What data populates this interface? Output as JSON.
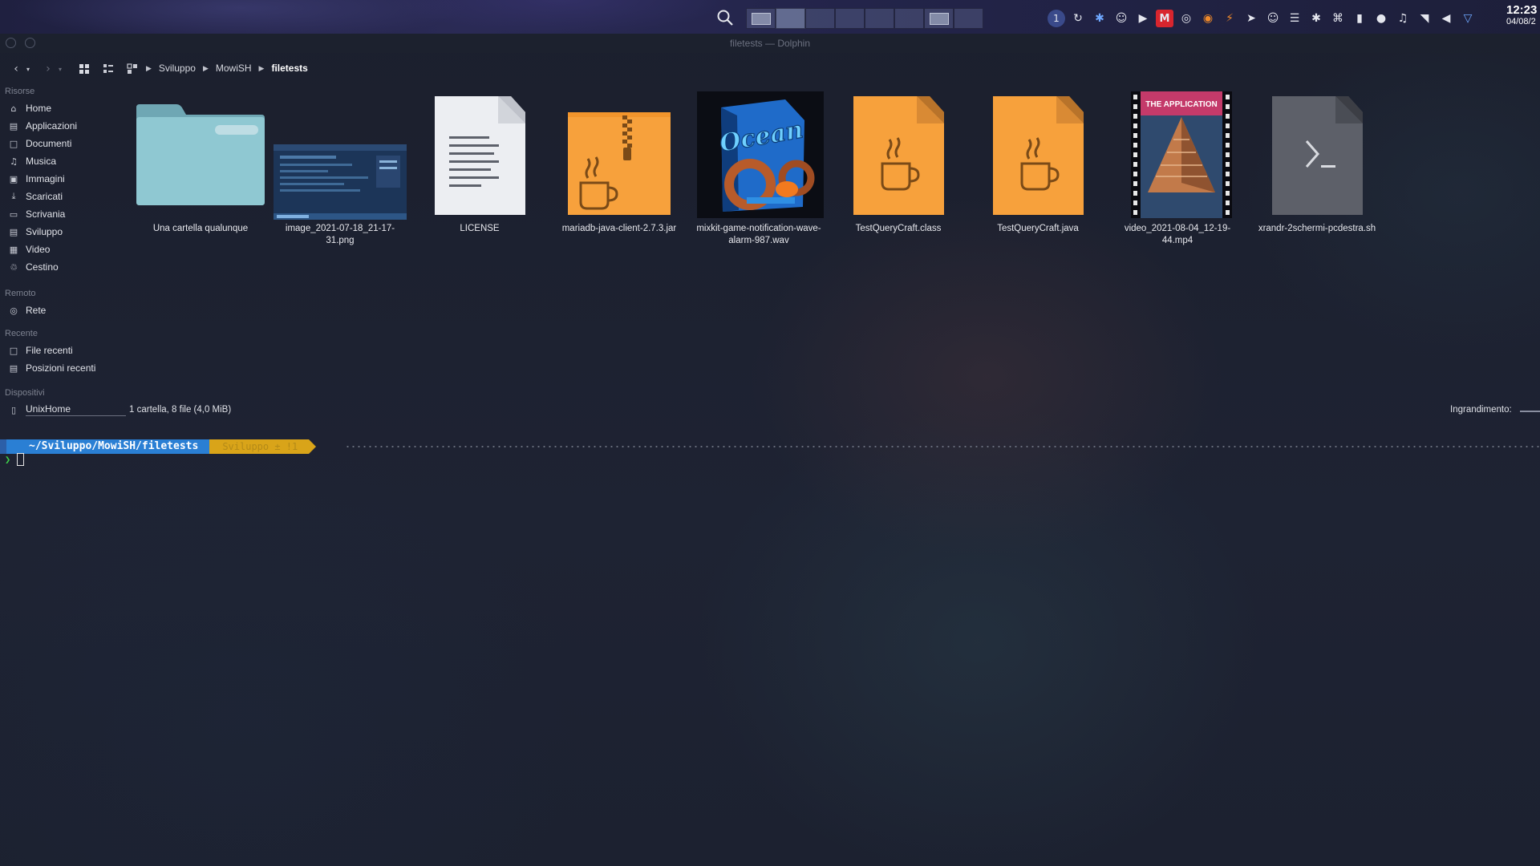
{
  "window": {
    "title": "filetests — Dolphin"
  },
  "panel": {
    "clock_time": "12:23",
    "clock_date": "04/08/2",
    "tray_icons": [
      "1-icon",
      "update-icon",
      "bluetooth-icon",
      "discord-icon",
      "play-icon",
      "mega-icon",
      "obs-icon",
      "record-icon",
      "power-icon",
      "telegram-icon",
      "user-icon",
      "clipboard-icon",
      "bluetooth-icon",
      "kdeconnect-icon",
      "battery-icon",
      "microphone-icon",
      "audio-icon",
      "wifi-icon",
      "volume-icon",
      "menu-arrow-icon"
    ]
  },
  "breadcrumb": [
    "Sviluppo",
    "MowiSH",
    "filetests"
  ],
  "sidebar": {
    "sections": [
      {
        "title": "Risorse",
        "items": [
          {
            "label": "Home",
            "icon": "home-icon"
          },
          {
            "label": "Applicazioni",
            "icon": "folder-icon"
          },
          {
            "label": "Documenti",
            "icon": "document-icon"
          },
          {
            "label": "Musica",
            "icon": "music-icon"
          },
          {
            "label": "Immagini",
            "icon": "image-icon"
          },
          {
            "label": "Scaricati",
            "icon": "download-icon"
          },
          {
            "label": "Scrivania",
            "icon": "desktop-icon"
          },
          {
            "label": "Sviluppo",
            "icon": "folder-icon"
          },
          {
            "label": "Video",
            "icon": "video-icon"
          },
          {
            "label": "Cestino",
            "icon": "trash-icon"
          }
        ]
      },
      {
        "title": "Remoto",
        "items": [
          {
            "label": "Rete",
            "icon": "network-icon"
          }
        ]
      },
      {
        "title": "Recente",
        "items": [
          {
            "label": "File recenti",
            "icon": "recent-files-icon"
          },
          {
            "label": "Posizioni recenti",
            "icon": "recent-places-icon"
          }
        ]
      },
      {
        "title": "Dispositivi",
        "items": [
          {
            "label": "UnixHome",
            "icon": "drive-icon"
          }
        ]
      }
    ]
  },
  "files": [
    {
      "name": "Una cartella qualunque",
      "kind": "folder"
    },
    {
      "name": "image_2021-07-18_21-17-31.png",
      "kind": "image"
    },
    {
      "name": "LICENSE",
      "kind": "text"
    },
    {
      "name": "mariadb-java-client-2.7.3.jar",
      "kind": "jar"
    },
    {
      "name": "mixkit-game-notification-wave-alarm-987.wav",
      "kind": "audio",
      "cover_text": "Ocean"
    },
    {
      "name": "TestQueryCraft.class",
      "kind": "java"
    },
    {
      "name": "TestQueryCraft.java",
      "kind": "java"
    },
    {
      "name": "video_2021-08-04_12-19-44.mp4",
      "kind": "video",
      "cover_text": "THE APPLICATION"
    },
    {
      "name": "xrandr-2schermi-pcdestra.sh",
      "kind": "script"
    }
  ],
  "status": {
    "summary": "1 cartella, 8 file (4,0 MiB)",
    "zoom_label": "Ingrandimento:"
  },
  "terminal": {
    "path": "~/Sviluppo/MowiSH/filetests",
    "branch": "Sviluppo ± !1"
  },
  "colors": {
    "folder": "#8fc8d2",
    "java": "#f7a13c",
    "prompt_path": "#2a7fd4",
    "prompt_branch": "#d9a419",
    "prompt_chevron": "#3ed14a"
  }
}
